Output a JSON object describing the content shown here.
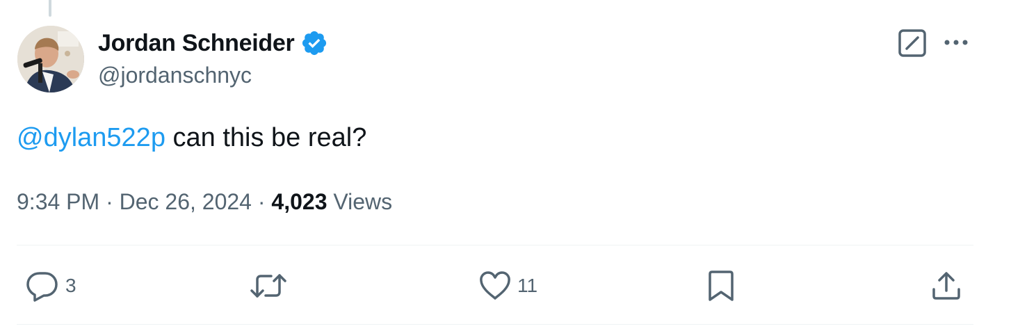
{
  "author": {
    "display_name": "Jordan Schneider",
    "handle": "@jordanschnyc",
    "verified": true,
    "verified_color": "#1d9bf0"
  },
  "tweet": {
    "mention": "@dylan522p",
    "text": " can this be real?",
    "mention_color": "#1d9bf0"
  },
  "meta": {
    "time": "9:34 PM",
    "separator": " · ",
    "date": "Dec 26, 2024",
    "views_count": "4,023",
    "views_label": " Views"
  },
  "header_actions": {
    "grok_icon": "grok-icon",
    "more_icon": "more-icon"
  },
  "actions": {
    "reply": {
      "icon": "reply-icon",
      "count": "3"
    },
    "retweet": {
      "icon": "retweet-icon",
      "count": ""
    },
    "like": {
      "icon": "heart-icon",
      "count": "11"
    },
    "bookmark": {
      "icon": "bookmark-icon"
    },
    "share": {
      "icon": "share-icon"
    }
  },
  "colors": {
    "text_primary": "#0f1419",
    "text_secondary": "#536471",
    "divider": "#eff3f4"
  }
}
